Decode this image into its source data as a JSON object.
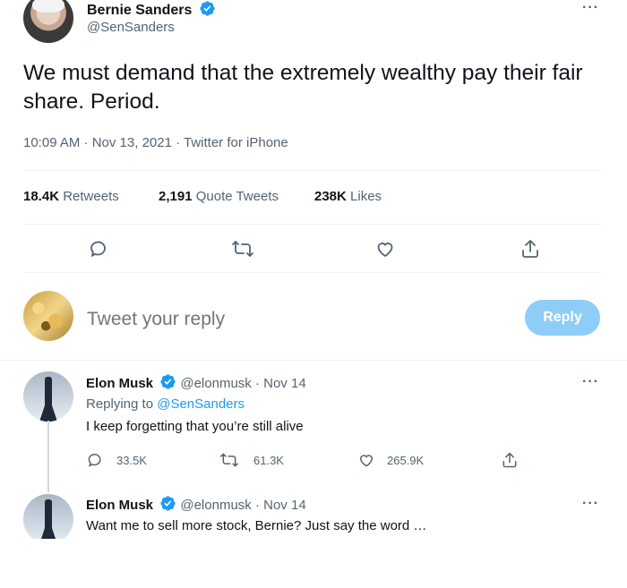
{
  "tweet": {
    "author_name": "Bernie Sanders",
    "author_handle": "@SenSanders",
    "text": "We must demand that the extremely wealthy pay their fair share. Period.",
    "timestamp": "10:09 AM · Nov 13, 2021 · Twitter for iPhone",
    "stats": {
      "retweets_count": "18.4K",
      "retweets_label": "Retweets",
      "quotes_count": "2,191",
      "quotes_label": "Quote Tweets",
      "likes_count": "238K",
      "likes_label": "Likes"
    },
    "more": "···"
  },
  "compose": {
    "placeholder": "Tweet your reply",
    "button_label": "Reply"
  },
  "replies": [
    {
      "author_name": "Elon Musk",
      "author_handle": "@elonmusk",
      "date": "· Nov 14",
      "replying_to_label": "Replying to",
      "replying_to_handle": "@SenSanders",
      "text": "I keep forgetting that you’re still alive",
      "replies_count": "33.5K",
      "retweets_count": "61.3K",
      "likes_count": "265.9K",
      "more": "···"
    },
    {
      "author_name": "Elon Musk",
      "author_handle": "@elonmusk",
      "date": "· Nov 14",
      "text": "Want me to sell more stock, Bernie? Just say the word …",
      "more": "···"
    }
  ],
  "colors": {
    "accent": "#1d9bf0",
    "reply_button_disabled": "#8ecdf7",
    "muted_text": "#536471",
    "divider": "#eff3f4"
  },
  "icons": [
    "verified-badge-icon",
    "reply-icon",
    "retweet-icon",
    "like-icon",
    "share-icon",
    "more-icon"
  ]
}
